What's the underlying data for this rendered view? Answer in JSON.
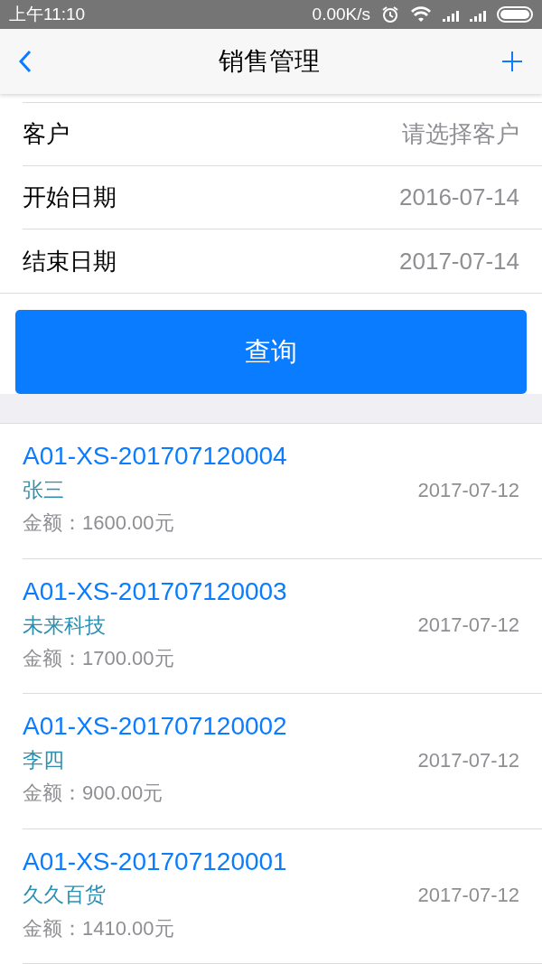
{
  "status_bar": {
    "time": "上午11:10",
    "speed": "0.00K/s"
  },
  "nav": {
    "title": "销售管理"
  },
  "filters": [
    {
      "label": "客户",
      "value": "请选择客户"
    },
    {
      "label": "开始日期",
      "value": "2016-07-14"
    },
    {
      "label": "结束日期",
      "value": "2017-07-14"
    }
  ],
  "query_button": "查询",
  "orders": [
    {
      "number": "A01-XS-201707120004",
      "customer": "张三",
      "date": "2017-07-12",
      "amount": "金额：1600.00元"
    },
    {
      "number": "A01-XS-201707120003",
      "customer": "未来科技",
      "date": "2017-07-12",
      "amount": "金额：1700.00元"
    },
    {
      "number": "A01-XS-201707120002",
      "customer": "李四",
      "date": "2017-07-12",
      "amount": "金额：900.00元"
    },
    {
      "number": "A01-XS-201707120001",
      "customer": "久久百货",
      "date": "2017-07-12",
      "amount": "金额：1410.00元"
    }
  ]
}
